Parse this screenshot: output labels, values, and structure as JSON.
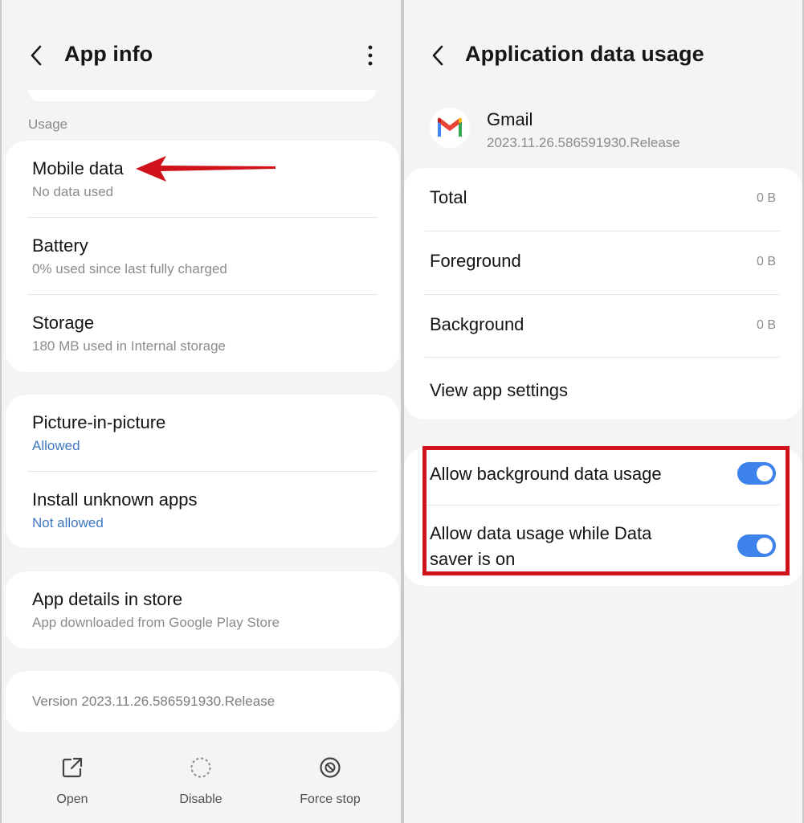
{
  "left": {
    "title": "App info",
    "section_usage": "Usage",
    "usage_items": [
      {
        "title": "Mobile data",
        "subtitle": "No data used"
      },
      {
        "title": "Battery",
        "subtitle": "0% used since last fully charged"
      },
      {
        "title": "Storage",
        "subtitle": "180 MB used in Internal storage"
      }
    ],
    "permission_items": [
      {
        "title": "Picture-in-picture",
        "subtitle": "Allowed"
      },
      {
        "title": "Install unknown apps",
        "subtitle": "Not allowed"
      }
    ],
    "store_item": {
      "title": "App details in store",
      "subtitle": "App downloaded from Google Play Store"
    },
    "version": "Version 2023.11.26.586591930.Release",
    "bottom_nav": {
      "open": "Open",
      "disable": "Disable",
      "force_stop": "Force stop"
    }
  },
  "right": {
    "title": "Application data usage",
    "app": {
      "name": "Gmail",
      "version": "2023.11.26.586591930.Release"
    },
    "usage_rows": [
      {
        "label": "Total",
        "value": "0 B"
      },
      {
        "label": "Foreground",
        "value": "0 B"
      },
      {
        "label": "Background",
        "value": "0 B"
      }
    ],
    "view_settings": "View app settings",
    "toggles": [
      {
        "label": "Allow background data usage",
        "enabled": true
      },
      {
        "label_line1": "Allow data usage while Data",
        "label_line2": "saver is on",
        "enabled": true
      }
    ]
  },
  "colors": {
    "accent_blue": "#3e82ec",
    "link_blue": "#3f78c2",
    "annotation_red": "#d0131b",
    "panel_bg": "#f4f4f4"
  },
  "icons": [
    "back-arrow-icon",
    "more-vert-icon",
    "open-external-icon",
    "disable-dashed-circle-icon",
    "force-stop-icon",
    "gmail-logo-icon",
    "red-arrow-annotation-icon"
  ]
}
